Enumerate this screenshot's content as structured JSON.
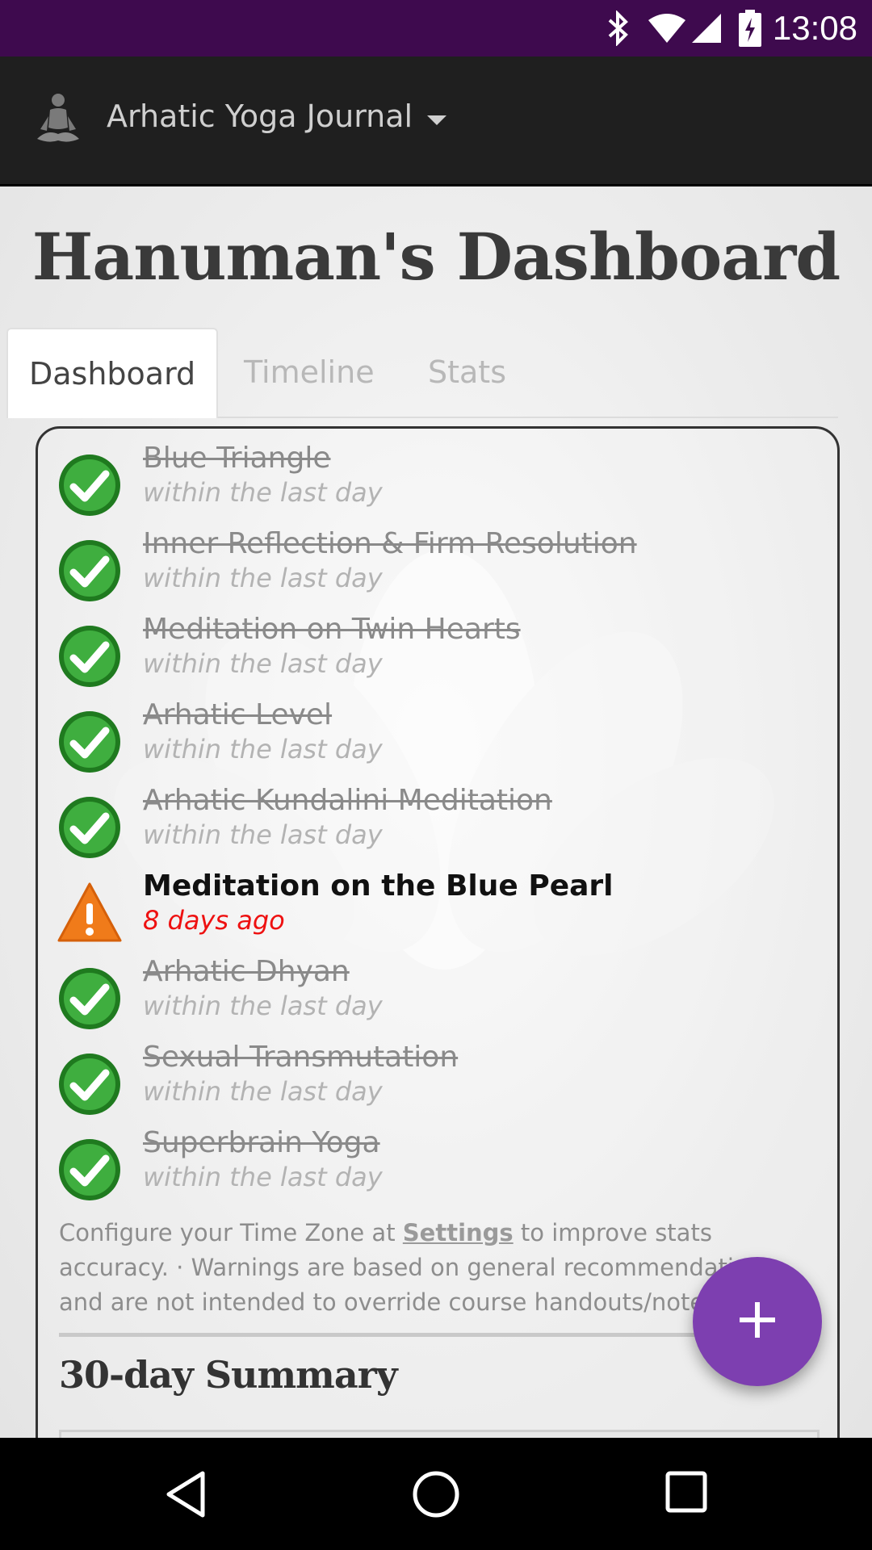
{
  "status_bar": {
    "time": "13:08",
    "icons": [
      "bluetooth-icon",
      "wifi-icon",
      "signal-icon",
      "battery-charging-icon"
    ],
    "background": "#3e0a4e"
  },
  "app_bar": {
    "title": "Arhatic Yoga Journal",
    "logo": "meditating-figure-icon",
    "dropdown_icon": "caret-down-icon"
  },
  "page": {
    "title": "Hanuman's Dashboard"
  },
  "tabs": [
    {
      "label": "Dashboard",
      "active": true
    },
    {
      "label": "Timeline",
      "active": false
    },
    {
      "label": "Stats",
      "active": false
    }
  ],
  "practices": [
    {
      "name": "Blue Triangle",
      "when": "within the last day",
      "status": "done"
    },
    {
      "name": "Inner Reflection & Firm Resolution",
      "when": "within the last day",
      "status": "done"
    },
    {
      "name": "Meditation on Twin Hearts",
      "when": "within the last day",
      "status": "done"
    },
    {
      "name": "Arhatic Level",
      "when": "within the last day",
      "status": "done"
    },
    {
      "name": "Arhatic Kundalini Meditation",
      "when": "within the last day",
      "status": "done"
    },
    {
      "name": "Meditation on the Blue Pearl",
      "when": "8 days ago",
      "status": "warning"
    },
    {
      "name": "Arhatic Dhyan",
      "when": "within the last day",
      "status": "done"
    },
    {
      "name": "Sexual Transmutation",
      "when": "within the last day",
      "status": "done"
    },
    {
      "name": "Superbrain Yoga",
      "when": "within the last day",
      "status": "done"
    }
  ],
  "note": {
    "prefix": "Configure your Time Zone at ",
    "link": "Settings",
    "suffix": " to improve stats accuracy. · Warnings are based on general recommendations and are not intended to override course handouts/notes."
  },
  "summary": {
    "title": "30-day Summary"
  },
  "fab": {
    "icon": "plus-icon",
    "color": "#7d3fb0"
  },
  "nav_bar": {
    "icons": [
      "back-icon",
      "home-icon",
      "recents-icon"
    ]
  },
  "colors": {
    "done": "#2e9b2e",
    "warning": "#f07b1a",
    "warning_text": "#ee1111"
  }
}
